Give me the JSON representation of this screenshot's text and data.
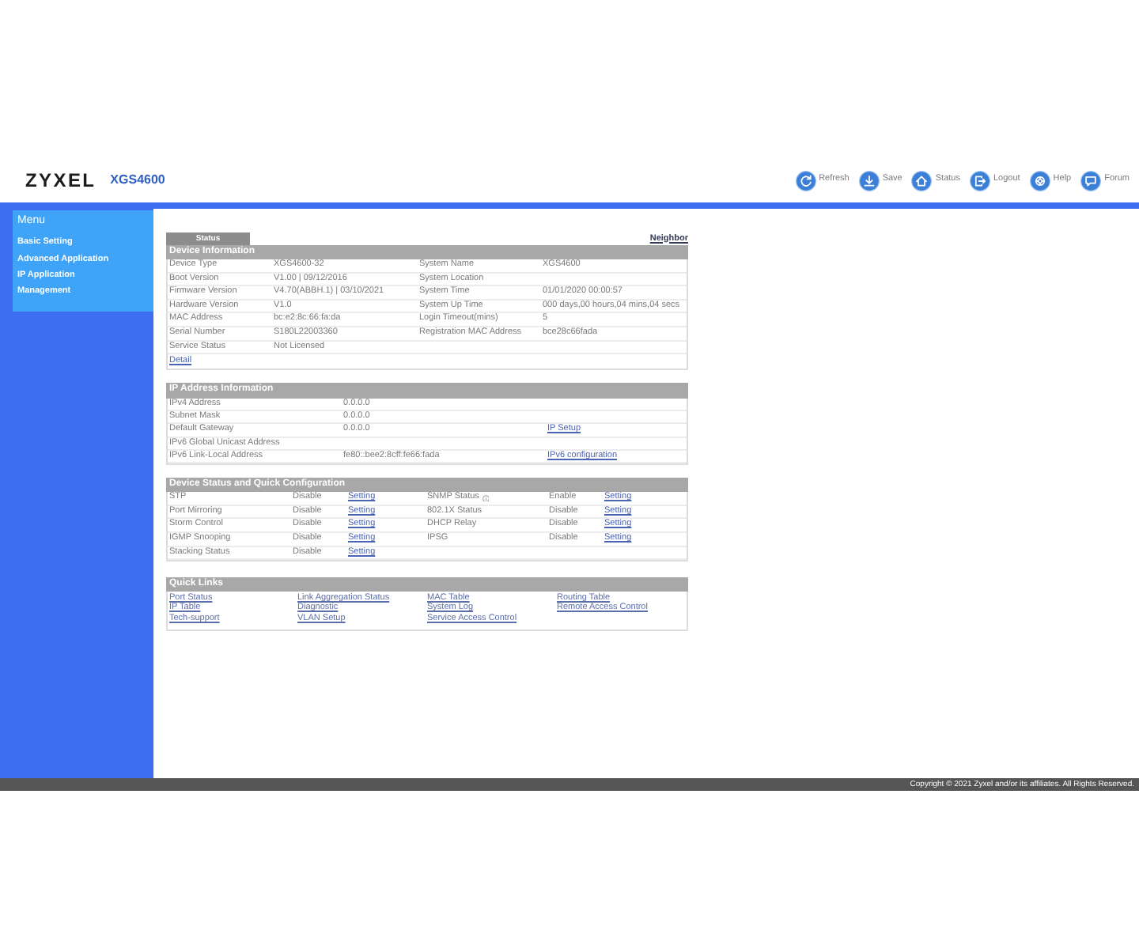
{
  "header": {
    "logo": "ZYXEL",
    "model": "XGS4600",
    "toolbar": [
      {
        "kind": "refresh",
        "label": "Refresh"
      },
      {
        "kind": "save",
        "label": "Save"
      },
      {
        "kind": "status",
        "label": "Status"
      },
      {
        "kind": "logout",
        "label": "Logout"
      },
      {
        "kind": "help",
        "label": "Help"
      },
      {
        "kind": "forum",
        "label": "Forum"
      }
    ]
  },
  "sidebar": {
    "title": "Menu",
    "items": [
      "Basic Setting",
      "Advanced Application",
      "IP Application",
      "Management"
    ]
  },
  "tabs": [
    {
      "label": "Status",
      "selected": true
    }
  ],
  "neighbor_link": "Neighbor",
  "device_information": {
    "title": "Device Information",
    "rows": [
      {
        "label": "Device Type",
        "value": "XGS4600-32",
        "label_2": "System Name",
        "value_2": "XGS4600"
      },
      {
        "label": "Boot Version",
        "value": "V1.00 | 09/12/2016",
        "label_2": "System Location"
      },
      {
        "label": "Firmware Version",
        "value": "V4.70(ABBH.1) | 03/10/2021",
        "label_2": "System Time",
        "value_2": "01/01/2020 00:00:57"
      },
      {
        "label": "Hardware Version",
        "value": "V1.0",
        "label_2": "System Up Time",
        "value_2": "000 days,00 hours,04 mins,04 secs"
      },
      {
        "label": "MAC Address",
        "value": "bc:e2:8c:66:fa:da",
        "label_2": "Login Timeout(mins)",
        "value_2": "5"
      },
      {
        "label": "Serial Number",
        "value": "S180L22003360",
        "label_2": "Registration MAC Address",
        "value_2": "bce28c66fada"
      },
      {
        "label": "Service Status",
        "value": "Not Licensed"
      }
    ],
    "link": "Detail"
  },
  "ip_address_information": {
    "title": "IP Address Information",
    "rows": [
      {
        "label": "IPv4 Address",
        "value": "0.0.0.0"
      },
      {
        "label": "Subnet Mask",
        "value": "0.0.0.0"
      },
      {
        "label": "Default Gateway",
        "value": "0.0.0.0",
        "link": "IP Setup"
      },
      {
        "label": "IPv6 Global Unicast Address"
      },
      {
        "label": "IPv6 Link-Local Address",
        "value": "fe80::bee2:8cff:fe66:fada",
        "link": "IPv6 configuration"
      }
    ]
  },
  "device_status": {
    "title": "Device Status and Quick Configuration",
    "rows": [
      {
        "left": {
          "name": "STP",
          "status": "Disable",
          "link": "Setting",
          "info": false
        },
        "right": {
          "name": "SNMP Status",
          "status": "Enable",
          "link": "Setting",
          "info": true
        }
      },
      {
        "left": {
          "name": "Port Mirroring",
          "status": "Disable",
          "link": "Setting",
          "info": false
        },
        "right": {
          "name": "802.1X Status",
          "status": "Disable",
          "link": "Setting",
          "info": false
        }
      },
      {
        "left": {
          "name": "Storm Control",
          "status": "Disable",
          "link": "Setting",
          "info": false
        },
        "right": {
          "name": "DHCP Relay",
          "status": "Disable",
          "link": "Setting",
          "info": false
        }
      },
      {
        "left": {
          "name": "IGMP Snooping",
          "status": "Disable",
          "link": "Setting",
          "info": false
        },
        "right": {
          "name": "IPSG",
          "status": "Disable",
          "link": "Setting",
          "info": false
        }
      },
      {
        "left": {
          "name": "Stacking Status",
          "status": "Disable",
          "link": "Setting",
          "info": false
        }
      }
    ]
  },
  "quick_links": {
    "title": "Quick Links",
    "rows": [
      [
        "Port Status",
        "Link Aggregation Status",
        "MAC Table",
        "Routing Table"
      ],
      [
        "IP Table",
        "Diagnostic",
        "System Log",
        "Remote Access Control"
      ],
      [
        "Tech-support",
        "VLAN Setup",
        "Service Access Control"
      ]
    ]
  },
  "footer": {
    "copyright": "Copyright © 2021 Zyxel and/or its affiliates. All Rights Reserved."
  }
}
